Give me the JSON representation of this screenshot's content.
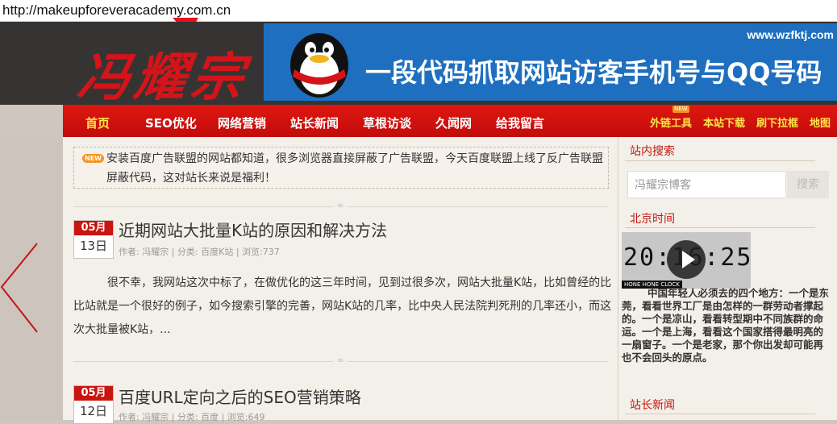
{
  "browser": {
    "url": "http://makeupforeveracademy.com.cn"
  },
  "header": {
    "logo_text": "冯耀宗",
    "banner": {
      "site": "www.wzfktj.com",
      "text": "一段代码抓取网站访客手机号与QQ号码"
    }
  },
  "nav": {
    "items": [
      "首页",
      "SEO优化",
      "网络营销",
      "站长新闻",
      "草根访谈",
      "久闻网",
      "给我留言"
    ],
    "right_items": [
      "外链工具",
      "本站下载",
      "刷下拉框",
      "地图"
    ],
    "new_badge": "NEW"
  },
  "notice": {
    "badge": "NEW",
    "text": "安装百度广告联盟的网站都知道，很多浏览器直接屏蔽了广告联盟，今天百度联盟上线了反广告联盟屏蔽代码，这对站长来说是福利！"
  },
  "posts": [
    {
      "month": "05月",
      "day": "13日",
      "title": "近期网站大批量K站的原因和解决方法",
      "meta": "作者: 冯耀宗 | 分类: 百度K站 | 浏览:737",
      "excerpt": "很不幸，我网站这次中标了，在做优化的这三年时间，见到过很多次，网站大批量K站，比如曾经的比比站就是一个很好的例子，如今搜索引擎的完善，网站K站的几率，比中央人民法院判死刑的几率还小，而这次大批量被K站，..."
    },
    {
      "month": "05月",
      "day": "12日",
      "title": "百度URL定向之后的SEO营销策略",
      "meta": "作者: 冯耀宗 | 分类: 百度 | 浏览:649"
    }
  ],
  "sidebar": {
    "search_title": "站内搜索",
    "search_placeholder": "冯耀宗博客",
    "search_button": "搜索",
    "time_title": "北京时间",
    "clock_time": "20:16:25",
    "clock_brand": "HONE HONE CLOCK",
    "poem": "中国年轻人必须去的四个地方：一个是东莞，看看世界工厂是由怎样的一群劳动者撑起的。一个是凉山，看看转型期中不同族群的命运。一个是上海，看看这个国家搭得最明亮的一扇窗子。一个是老家，那个你出发却可能再也不会回头的原点。",
    "news_title": "站长新闻"
  },
  "colors": {
    "nav_red": "#d8120d",
    "accent_yellow": "#ffe24a",
    "brand_red": "#c3180e",
    "banner_blue": "#1e6fbf"
  }
}
